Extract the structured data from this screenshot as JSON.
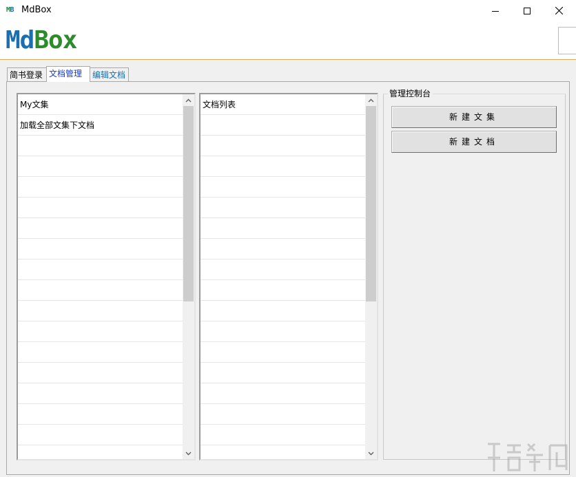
{
  "window": {
    "icon_text_m": "M",
    "icon_text_b": "B",
    "title": "MdBox",
    "controls": [
      "minimize",
      "maximize",
      "close"
    ]
  },
  "header": {
    "logo_part1": "Md",
    "logo_part2": "Box",
    "accent_color": "#e8a34a"
  },
  "tabs": [
    {
      "label": "简书登录"
    },
    {
      "label": "文档管理",
      "active": true
    },
    {
      "label": "编辑文档"
    }
  ],
  "left_list": {
    "items": [
      "My文集",
      "加载全部文集下文档"
    ]
  },
  "middle_list": {
    "items": [
      "文档列表"
    ]
  },
  "control_panel": {
    "title": "管理控制台",
    "buttons": [
      "新建文集",
      "新建文档"
    ]
  },
  "colors": {
    "tab_active_text": "#1a3cc6",
    "tab_edit_text": "#1a6fb0",
    "logo_blue": "#1a6fb0",
    "logo_green": "#2d8a2d"
  }
}
